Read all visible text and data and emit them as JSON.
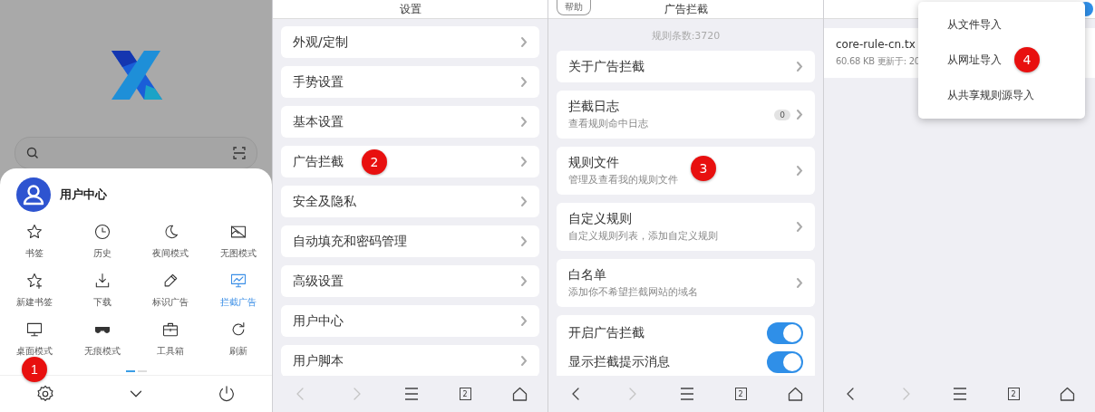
{
  "menu_screen": {
    "user": {
      "name": "用户中心"
    },
    "tools": [
      {
        "kind": "star",
        "label": "书签",
        "active": false
      },
      {
        "kind": "clock",
        "label": "历史",
        "active": false
      },
      {
        "kind": "moon",
        "label": "夜间模式",
        "active": false
      },
      {
        "kind": "noimage",
        "label": "无图模式",
        "active": false
      },
      {
        "kind": "starplus",
        "label": "新建书签",
        "active": false
      },
      {
        "kind": "download",
        "label": "下载",
        "active": false
      },
      {
        "kind": "pen",
        "label": "标识广告",
        "active": false
      },
      {
        "kind": "monitorchart",
        "label": "拦截广告",
        "active": true
      },
      {
        "kind": "monitor",
        "label": "桌面模式",
        "active": false
      },
      {
        "kind": "mask",
        "label": "无痕模式",
        "active": false
      },
      {
        "kind": "toolbox",
        "label": "工具箱",
        "active": false
      },
      {
        "kind": "refresh",
        "label": "刷新",
        "active": false
      }
    ],
    "pager": [
      {
        "selected": true
      },
      {
        "selected": false
      }
    ],
    "bottom": [
      {
        "kind": "gear",
        "step": "1"
      },
      {
        "kind": "chevron"
      },
      {
        "kind": "power"
      }
    ]
  },
  "settings_screen": {
    "title": "设置",
    "items": [
      {
        "label": "外观/定制"
      },
      {
        "label": "手势设置"
      },
      {
        "label": "基本设置"
      },
      {
        "label": "广告拦截",
        "step": "2"
      },
      {
        "label": "安全及隐私"
      },
      {
        "label": "自动填充和密码管理"
      },
      {
        "label": "高级设置"
      },
      {
        "label": "用户中心"
      },
      {
        "label": "用户脚本"
      }
    ],
    "nav": {
      "back_disabled": true,
      "forward_disabled": true,
      "tab_count": "2"
    }
  },
  "adblock_screen": {
    "help_button": "帮助",
    "title": "广告拦截",
    "rule_count": "规则条数:3720",
    "items": [
      {
        "kind": "link",
        "label": "关于广告拦截"
      },
      {
        "kind": "link",
        "label": "拦截日志",
        "subtitle": "查看规则命中日志",
        "count": "0"
      },
      {
        "kind": "link",
        "label": "规则文件",
        "subtitle": "管理及查看我的规则文件",
        "step": "3"
      },
      {
        "kind": "link",
        "label": "自定义规则",
        "subtitle": "自定义规则列表，添加自定义规则"
      },
      {
        "kind": "link",
        "label": "白名单",
        "subtitle": "添加你不希望拦截网站的域名"
      }
    ],
    "toggles": [
      {
        "label": "开启广告拦截",
        "on": true
      },
      {
        "label": "显示拦截提示消息",
        "on": true
      }
    ],
    "nav": {
      "back_disabled": false,
      "forward_disabled": true,
      "tab_count": "2"
    }
  },
  "rules_screen": {
    "file": {
      "name": "core-rule-cn.tx",
      "info": "60.68 KB 更新于: 20"
    },
    "import_menu": [
      {
        "label": "从文件导入"
      },
      {
        "label": "从网址导入",
        "step": "4"
      },
      {
        "label": "从共享规则源导入"
      }
    ],
    "nav": {
      "back_disabled": false,
      "forward_disabled": true,
      "tab_count": "2"
    }
  }
}
